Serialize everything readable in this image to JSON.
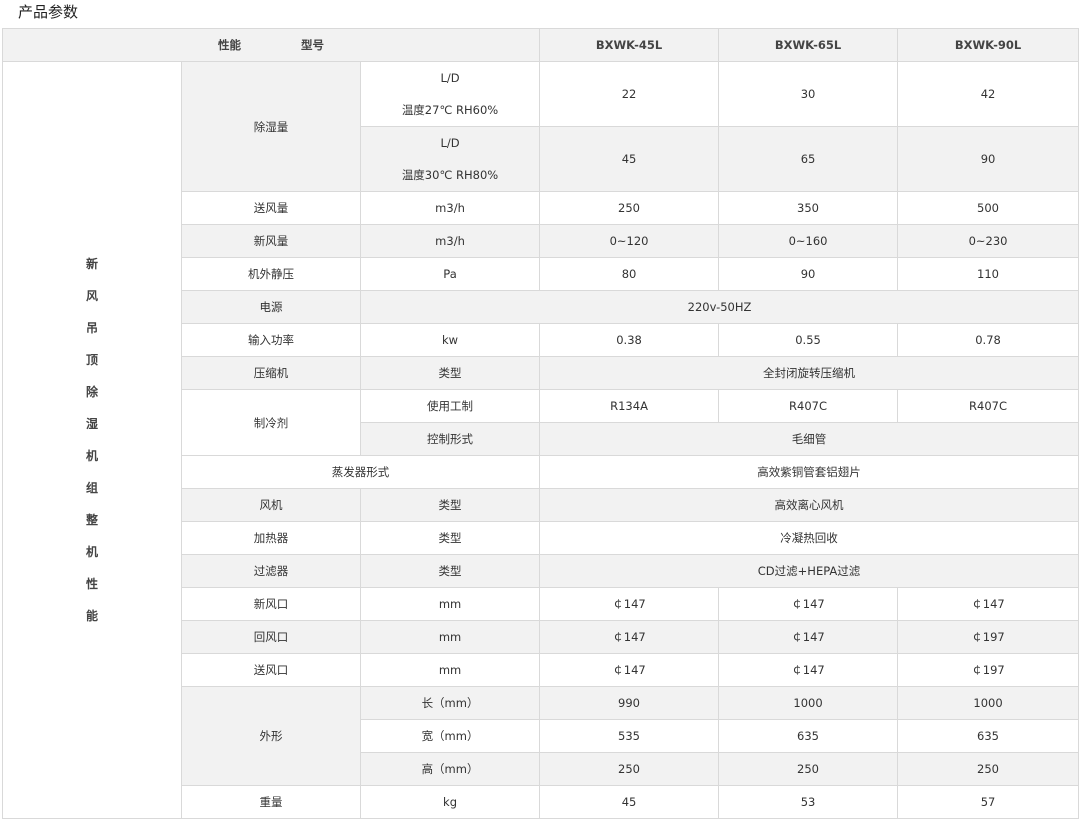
{
  "page_title": "产品参数",
  "header": {
    "performance": "性能",
    "model": "型号",
    "models": [
      "BXWK-45L",
      "BXWK-65L",
      "BXWK-90L"
    ]
  },
  "side_label_chars": [
    "新",
    "风",
    "吊",
    "顶",
    "除",
    "湿",
    "机",
    "组",
    "整",
    "机",
    "性",
    "能"
  ],
  "dehumid": {
    "label": "除湿量",
    "row1": {
      "unit": "L/D",
      "cond": "温度27℃ RH60%",
      "values": [
        "22",
        "30",
        "42"
      ]
    },
    "row2": {
      "unit": "L/D",
      "cond": "温度30℃ RH80%",
      "values": [
        "45",
        "65",
        "90"
      ]
    }
  },
  "supply_air": {
    "label": "送风量",
    "unit": "m3/h",
    "values": [
      "250",
      "350",
      "500"
    ]
  },
  "fresh_air": {
    "label": "新风量",
    "unit": "m3/h",
    "values": [
      "0~120",
      "0~160",
      "0~230"
    ]
  },
  "static_pressure": {
    "label": "机外静压",
    "unit": "Pa",
    "values": [
      "80",
      "90",
      "110"
    ]
  },
  "power_supply": {
    "label": "电源",
    "value": "220v-50HZ"
  },
  "input_power": {
    "label": "输入功率",
    "unit": "kw",
    "values": [
      "0.38",
      "0.55",
      "0.78"
    ]
  },
  "compressor": {
    "label": "压缩机",
    "unit": "类型",
    "value": "全封闭旋转压缩机"
  },
  "refrigerant": {
    "label": "制冷剂",
    "use": {
      "unit": "使用工制",
      "values": [
        "R134A",
        "R407C",
        "R407C"
      ]
    },
    "control": {
      "unit": "控制形式",
      "value": "毛细管"
    }
  },
  "evaporator": {
    "label": "蒸发器形式",
    "value": "高效紫铜管套铝翅片"
  },
  "fan": {
    "label": "风机",
    "unit": "类型",
    "value": "高效离心风机"
  },
  "heater": {
    "label": "加热器",
    "unit": "类型",
    "value": "冷凝热回收"
  },
  "filter": {
    "label": "过滤器",
    "unit": "类型",
    "value": "CD过滤+HEPA过滤"
  },
  "fresh_inlet": {
    "label": "新风口",
    "unit": "mm",
    "values": [
      "￠147",
      "￠147",
      "￠147"
    ]
  },
  "return_inlet": {
    "label": "回风口",
    "unit": "mm",
    "values": [
      "￠147",
      "￠147",
      "￠197"
    ]
  },
  "supply_outlet": {
    "label": "送风口",
    "unit": "mm",
    "values": [
      "￠147",
      "￠147",
      "￠197"
    ]
  },
  "shape": {
    "label": "外形",
    "length": {
      "unit": "长（mm）",
      "values": [
        "990",
        "1000",
        "1000"
      ]
    },
    "width": {
      "unit": "宽（mm）",
      "values": [
        "535",
        "635",
        "635"
      ]
    },
    "height": {
      "unit": "高（mm）",
      "values": [
        "250",
        "250",
        "250"
      ]
    }
  },
  "weight": {
    "label": "重量",
    "unit": "kg",
    "values": [
      "45",
      "53",
      "57"
    ]
  }
}
